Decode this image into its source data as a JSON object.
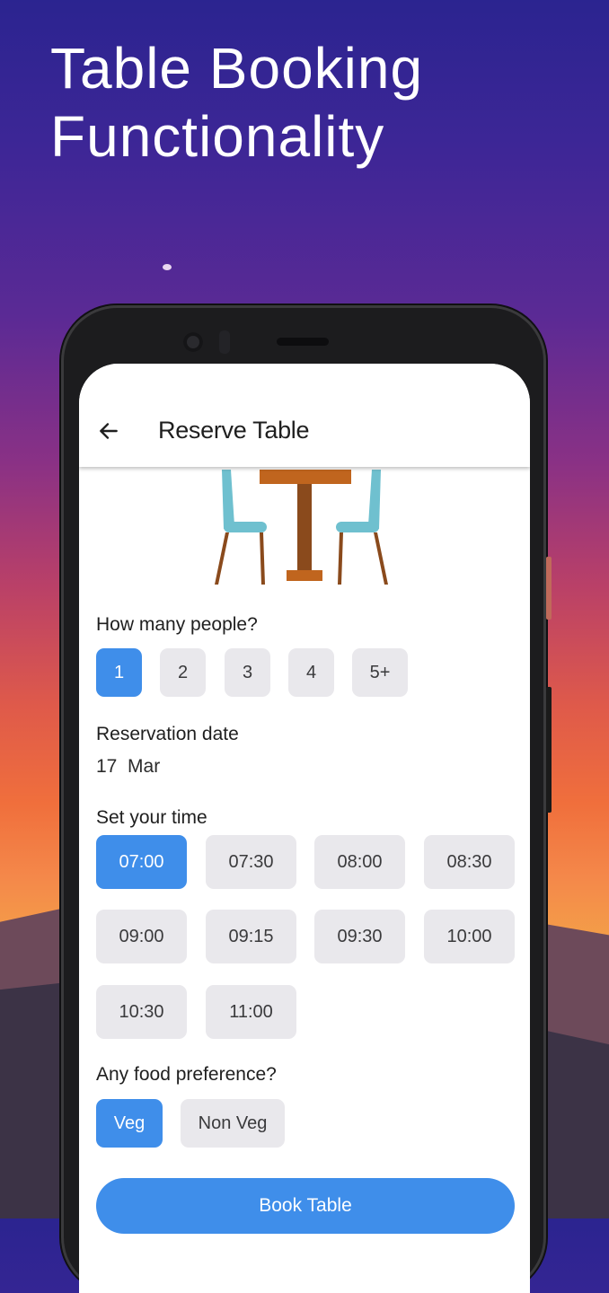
{
  "promo": {
    "headline_line1": "Table Booking",
    "headline_line2": "Functionality"
  },
  "appbar": {
    "back_icon": "arrow-left-icon",
    "title": "Reserve Table"
  },
  "illustration": "table-and-chairs-illustration",
  "people": {
    "label": "How many people?",
    "options": [
      "1",
      "2",
      "3",
      "4",
      "5+"
    ],
    "selected": "1"
  },
  "date": {
    "label": "Reservation date",
    "value": "17  Mar"
  },
  "time": {
    "label": "Set your time",
    "options": [
      "07:00",
      "07:30",
      "08:00",
      "08:30",
      "09:00",
      "09:15",
      "09:30",
      "10:00",
      "10:30",
      "11:00"
    ],
    "selected": "07:00"
  },
  "food": {
    "label": "Any food preference?",
    "options": [
      "Veg",
      "Non Veg"
    ],
    "selected": "Veg"
  },
  "book_button": "Book Table",
  "colors": {
    "accent": "#3f8eea",
    "chip_bg": "#e9e8ec",
    "table_wood": "#c0651e",
    "chair_seat": "#6fc0cf",
    "chair_leg": "#8a4a1c"
  }
}
